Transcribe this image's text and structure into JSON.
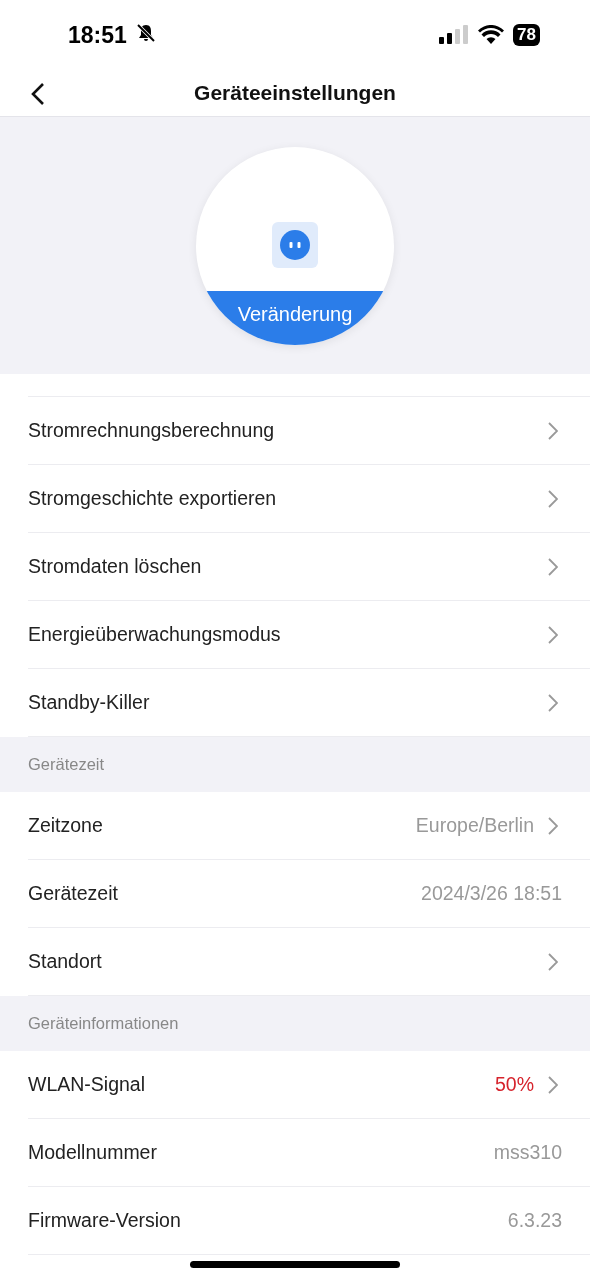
{
  "status_bar": {
    "time": "18:51",
    "silent": true,
    "battery": "78"
  },
  "header": {
    "title": "Geräteeinstellungen"
  },
  "device": {
    "button_label": "Veränderung"
  },
  "sections": [
    {
      "rows": [
        {
          "label": "Stromrechnungsberechnung",
          "chevron": true
        },
        {
          "label": "Stromgeschichte exportieren",
          "chevron": true
        },
        {
          "label": "Stromdaten löschen",
          "chevron": true
        },
        {
          "label": "Energieüberwachungsmodus",
          "chevron": true
        },
        {
          "label": "Standby-Killer",
          "chevron": true
        }
      ]
    },
    {
      "title": "Gerätezeit",
      "rows": [
        {
          "label": "Zeitzone",
          "value": "Europe/Berlin",
          "alert": false,
          "chevron": true
        },
        {
          "label": "Gerätezeit",
          "value": "2024/3/26 18:51",
          "alert": false,
          "chevron": false
        },
        {
          "label": "Standort",
          "chevron": true
        }
      ]
    },
    {
      "title": "Geräteinformationen",
      "rows": [
        {
          "label": "WLAN-Signal",
          "value": "50%",
          "alert": true,
          "chevron": true
        },
        {
          "label": "Modellnummer",
          "value": "mss310",
          "alert": false,
          "chevron": false
        },
        {
          "label": "Firmware-Version",
          "value": "6.3.23",
          "alert": false,
          "chevron": false
        }
      ]
    }
  ]
}
